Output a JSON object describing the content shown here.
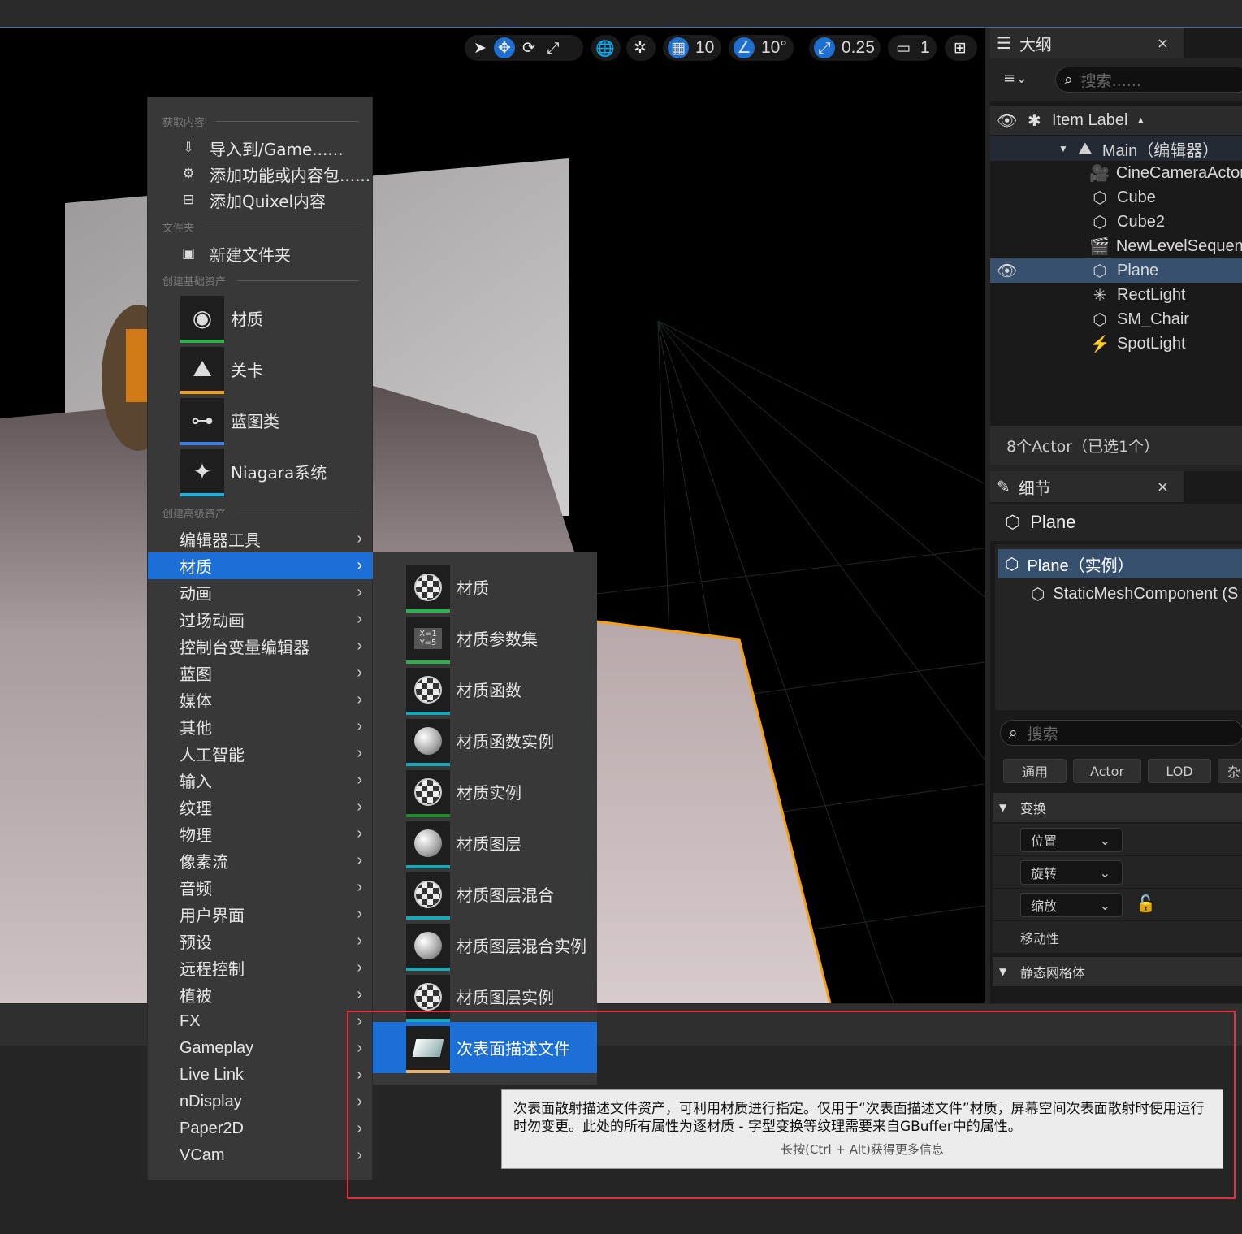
{
  "toolbar": {
    "grid_value": "10",
    "angle_value": "10°",
    "scale_value": "0.25",
    "camera_value": "1",
    "accent": "#1f6fd0"
  },
  "outliner": {
    "title": "大纲",
    "close": "×",
    "search_placeholder": "搜索......",
    "column_label": "Item Label",
    "rows": [
      {
        "label": "Main（编辑器）",
        "icon": "level-icon"
      },
      {
        "label": "CineCameraActor",
        "icon": "camera-icon"
      },
      {
        "label": "Cube",
        "icon": "cube-icon"
      },
      {
        "label": "Cube2",
        "icon": "cube-icon"
      },
      {
        "label": "NewLevelSequence",
        "icon": "clapper-icon"
      },
      {
        "label": "Plane",
        "icon": "cube-icon",
        "selected": true
      },
      {
        "label": "RectLight",
        "icon": "light-icon"
      },
      {
        "label": "SM_Chair",
        "icon": "cube-icon"
      },
      {
        "label": "SpotLight",
        "icon": "spotlight-icon"
      }
    ],
    "status": "8个Actor（已选1个）"
  },
  "details": {
    "title": "细节",
    "close": "×",
    "object_name": "Plane",
    "instance_label": "Plane（实例）",
    "component_label": "StaticMeshComponent (S",
    "search_placeholder": "搜索",
    "filter_buttons": [
      "通用",
      "Actor",
      "LOD",
      "杂"
    ],
    "transform_section": "变换",
    "location": "位置",
    "rotation": "旋转",
    "scale": "缩放",
    "mobility": "移动性",
    "static_mesh_section": "静态网格体"
  },
  "menu": {
    "section_get_content": "获取内容",
    "import": "导入到/Game......",
    "add_feature": "添加功能或内容包......",
    "add_quixel": "添加Quixel内容",
    "section_folder": "文件夹",
    "new_folder": "新建文件夹",
    "section_basic": "创建基础资产",
    "basic_assets": [
      {
        "label": "材质",
        "color": "#2bb24a"
      },
      {
        "label": "关卡",
        "color": "#f0a020"
      },
      {
        "label": "蓝图类",
        "color": "#3d7fe0"
      },
      {
        "label": "Niagara系统",
        "color": "#1ab0e0"
      }
    ],
    "section_advanced": "创建高级资产",
    "advanced_items": [
      "编辑器工具",
      "材质",
      "动画",
      "过场动画",
      "控制台变量编辑器",
      "蓝图",
      "媒体",
      "其他",
      "人工智能",
      "输入",
      "纹理",
      "物理",
      "像素流",
      "音频",
      "用户界面",
      "预设",
      "远程控制",
      "植被",
      "FX",
      "Gameplay",
      "Live Link",
      "nDisplay",
      "Paper2D",
      "VCam"
    ],
    "highlighted_index": 1
  },
  "submenu": {
    "items": [
      {
        "label": "材质",
        "color": "#2bb24a"
      },
      {
        "label": "材质参数集",
        "color": "#2bb24a"
      },
      {
        "label": "材质函数",
        "color": "#18a8b8"
      },
      {
        "label": "材质函数实例",
        "color": "#18a8b8"
      },
      {
        "label": "材质实例",
        "color": "#1f8a2a"
      },
      {
        "label": "材质图层",
        "color": "#18a8b8"
      },
      {
        "label": "材质图层混合",
        "color": "#18a8b8"
      },
      {
        "label": "材质图层混合实例",
        "color": "#18a8b8"
      },
      {
        "label": "材质图层实例",
        "color": "#18a8b8"
      },
      {
        "label": "次表面描述文件",
        "color": "#e6b070"
      }
    ],
    "highlighted_index": 9
  },
  "tooltip": {
    "text": "次表面散射描述文件资产，可利用材质进行指定。仅用于“次表面描述文件”材质，屏幕空间次表面散射时使用运行时勿变更。此处的所有属性为逐材质 - 字型变换等纹理需要来自GBuffer中的属性。",
    "hint": "长按(Ctrl + Alt)获得更多信息"
  }
}
